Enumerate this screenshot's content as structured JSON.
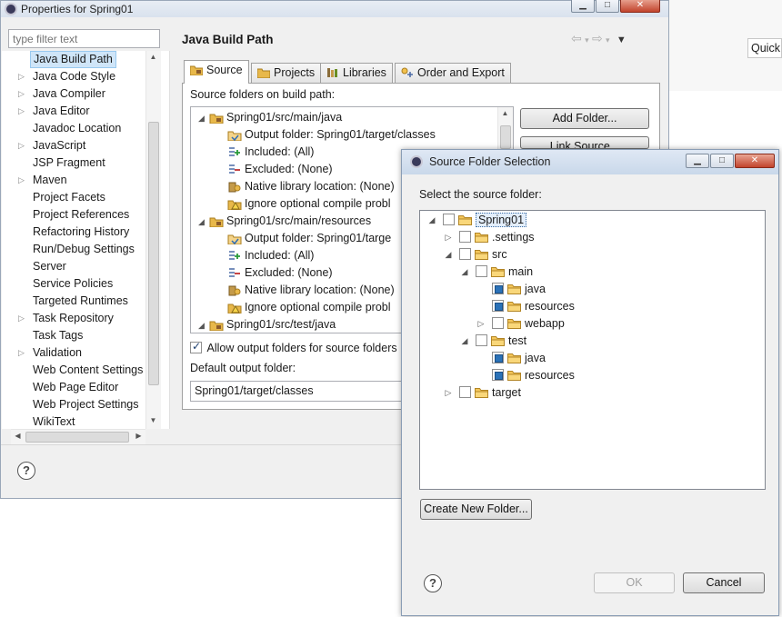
{
  "props_window": {
    "title": "Properties for Spring01",
    "filter_placeholder": "type filter text",
    "nav_items": [
      {
        "label": "Java Build Path",
        "expandable": false,
        "selected": true
      },
      {
        "label": "Java Code Style",
        "expandable": true
      },
      {
        "label": "Java Compiler",
        "expandable": true
      },
      {
        "label": "Java Editor",
        "expandable": true
      },
      {
        "label": "Javadoc Location",
        "expandable": false
      },
      {
        "label": "JavaScript",
        "expandable": true
      },
      {
        "label": "JSP Fragment",
        "expandable": false
      },
      {
        "label": "Maven",
        "expandable": true
      },
      {
        "label": "Project Facets",
        "expandable": false
      },
      {
        "label": "Project References",
        "expandable": false
      },
      {
        "label": "Refactoring History",
        "expandable": false
      },
      {
        "label": "Run/Debug Settings",
        "expandable": false
      },
      {
        "label": "Server",
        "expandable": false
      },
      {
        "label": "Service Policies",
        "expandable": false
      },
      {
        "label": "Targeted Runtimes",
        "expandable": false
      },
      {
        "label": "Task Repository",
        "expandable": true
      },
      {
        "label": "Task Tags",
        "expandable": false
      },
      {
        "label": "Validation",
        "expandable": true
      },
      {
        "label": "Web Content Settings",
        "expandable": false
      },
      {
        "label": "Web Page Editor",
        "expandable": false
      },
      {
        "label": "Web Project Settings",
        "expandable": false
      },
      {
        "label": "WikiText",
        "expandable": false
      }
    ],
    "page_title": "Java Build Path",
    "tabs": [
      {
        "label": "Source",
        "active": true,
        "icon": "source-folder-icon"
      },
      {
        "label": "Projects",
        "active": false,
        "icon": "projects-icon"
      },
      {
        "label": "Libraries",
        "active": false,
        "icon": "libraries-icon"
      },
      {
        "label": "Order and Export",
        "active": false,
        "icon": "order-export-icon"
      }
    ],
    "source_label": "Source folders on build path:",
    "source_tree": [
      {
        "text": "Spring01/src/main/java",
        "level": 0,
        "icon": "package-folder-icon"
      },
      {
        "text": "Output folder: Spring01/target/classes",
        "level": 1,
        "icon": "output-folder-icon"
      },
      {
        "text": "Included: (All)",
        "level": 1,
        "icon": "included-icon"
      },
      {
        "text": "Excluded: (None)",
        "level": 1,
        "icon": "excluded-icon"
      },
      {
        "text": "Native library location: (None)",
        "level": 1,
        "icon": "native-library-icon"
      },
      {
        "text": "Ignore optional compile probl",
        "level": 1,
        "icon": "ignore-warnings-icon"
      },
      {
        "text": "Spring01/src/main/resources",
        "level": 0,
        "icon": "package-folder-icon"
      },
      {
        "text": "Output folder: Spring01/targe",
        "level": 1,
        "icon": "output-folder-icon"
      },
      {
        "text": "Included: (All)",
        "level": 1,
        "icon": "included-icon"
      },
      {
        "text": "Excluded: (None)",
        "level": 1,
        "icon": "excluded-icon"
      },
      {
        "text": "Native library location: (None)",
        "level": 1,
        "icon": "native-library-icon"
      },
      {
        "text": "Ignore optional compile probl",
        "level": 1,
        "icon": "ignore-warnings-icon"
      },
      {
        "text": "Spring01/src/test/java",
        "level": 0,
        "icon": "package-folder-icon"
      }
    ],
    "buttons": {
      "add_folder": "Add Folder...",
      "link_source": "Link Source..."
    },
    "allow_output_label": "Allow output folders for source folders",
    "allow_output_checked": true,
    "default_output_label": "Default output folder:",
    "default_output_value": "Spring01/target/classes",
    "help_label": "?"
  },
  "background": {
    "quick_access": "Quick"
  },
  "dialog": {
    "title": "Source Folder Selection",
    "prompt": "Select the source folder:",
    "tree": [
      {
        "label": "Spring01",
        "level": 0,
        "expander": "open",
        "state": "unchecked",
        "selected": true
      },
      {
        "label": ".settings",
        "level": 1,
        "expander": "closed",
        "state": "unchecked"
      },
      {
        "label": "src",
        "level": 1,
        "expander": "open",
        "state": "unchecked"
      },
      {
        "label": "main",
        "level": 2,
        "expander": "open",
        "state": "unchecked"
      },
      {
        "label": "java",
        "level": 3,
        "expander": "none",
        "state": "partial"
      },
      {
        "label": "resources",
        "level": 3,
        "expander": "none",
        "state": "partial"
      },
      {
        "label": "webapp",
        "level": 3,
        "expander": "closed",
        "state": "unchecked"
      },
      {
        "label": "test",
        "level": 2,
        "expander": "open",
        "state": "unchecked"
      },
      {
        "label": "java",
        "level": 3,
        "expander": "none",
        "state": "partial"
      },
      {
        "label": "resources",
        "level": 3,
        "expander": "none",
        "state": "partial"
      },
      {
        "label": "target",
        "level": 1,
        "expander": "closed",
        "state": "unchecked"
      }
    ],
    "create_folder_label": "Create New Folder...",
    "ok_label": "OK",
    "cancel_label": "Cancel",
    "ok_enabled": false
  },
  "colors": {
    "selection": "#cfe5f8",
    "folder": "#e8b84a",
    "checkbox_fill": "#2b72b8"
  }
}
